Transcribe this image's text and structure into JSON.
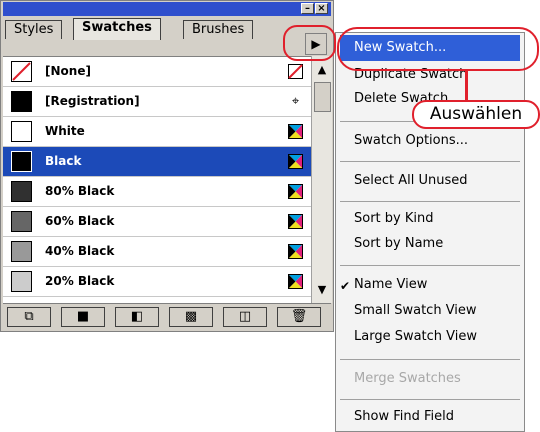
{
  "tabs": [
    "Styles",
    "Swatches",
    "Brushes"
  ],
  "panel_menu_icon": "triangle-right-icon",
  "swatches": [
    {
      "label": "[None]",
      "chip": "#ffffff",
      "icon": "none-icon"
    },
    {
      "label": "[Registration]",
      "chip": "#000000",
      "icon": "registration-icon"
    },
    {
      "label": "White",
      "chip": "#ffffff",
      "icon": "process-color-icon"
    },
    {
      "label": "Black",
      "chip": "#000000",
      "icon": "process-color-icon",
      "selected": true
    },
    {
      "label": "80% Black",
      "chip": "#303030",
      "icon": "process-color-icon"
    },
    {
      "label": "60% Black",
      "chip": "#666666",
      "icon": "process-color-icon"
    },
    {
      "label": "40% Black",
      "chip": "#999999",
      "icon": "process-color-icon"
    },
    {
      "label": "20% Black",
      "chip": "#cccccc",
      "icon": "process-color-icon"
    }
  ],
  "bottom_buttons": [
    "show-all-icon",
    "color-swatches-icon",
    "gradient-swatches-icon",
    "pattern-swatches-icon",
    "new-swatch-icon",
    "trash-icon"
  ],
  "menu": {
    "items": [
      {
        "label": "New Swatch...",
        "highlighted": true
      },
      {
        "label": "Duplicate Swatch"
      },
      {
        "label": "Delete Swatch"
      },
      {
        "label": "Swatch Options..."
      },
      {
        "label": "Select All Unused"
      },
      {
        "label": "Sort by Kind"
      },
      {
        "label": "Sort by Name"
      },
      {
        "label": "Name View",
        "checked": true
      },
      {
        "label": "Small Swatch View"
      },
      {
        "label": "Large Swatch View"
      },
      {
        "label": "Merge Swatches",
        "disabled": true
      },
      {
        "label": "Show Find Field"
      }
    ]
  },
  "callout": "Auswählen",
  "colors": {
    "accent": "#2f5fd8",
    "annotation": "#e0202c",
    "selection": "#1c4ab8"
  }
}
